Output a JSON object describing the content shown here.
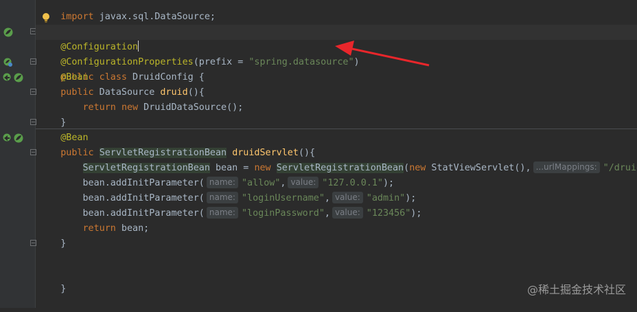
{
  "editor": {
    "lines": {
      "l0": {
        "kw": "import",
        "rest": " javax.sql.DataSource;"
      },
      "l1": {
        "ann": "@Configuration"
      },
      "l2": {
        "ann": "@ConfigurationProperties",
        "open": "(prefix = ",
        "str": "\"spring.datasource\"",
        "close": ")"
      },
      "l3": {
        "kw1": "public class",
        "rest": " DruidConfig {"
      },
      "l4": {
        "ann": "@Bean"
      },
      "l5": {
        "kw": "public",
        "type": " DataSource ",
        "method": "druid",
        "rest": "(){"
      },
      "l6": {
        "kw1": "return",
        "sp": " ",
        "kw2": "new",
        "rest": " DruidDataSource();"
      },
      "l7": {
        "rest": "}"
      },
      "l8": {
        "ann": "@Bean"
      },
      "l9": {
        "kw": "public",
        "type": "ServletRegistrationBean",
        "method": "druidServlet",
        "rest": "(){"
      },
      "l10": {
        "type": "ServletRegistrationBean",
        "mid": " bean = ",
        "kw": "new",
        "type2": "ServletRegistrationBean",
        "open": "(",
        "kw2": "new",
        "call": " StatViewServlet(),",
        "hint": "...urlMappings:",
        "str": "\"/druid"
      },
      "l11": {
        "call": "bean.addInitParameter(",
        "hint1": "name:",
        "str1": "\"allow\"",
        "comma": ",",
        "hint2": "value:",
        "str2": "\"127.0.0.1\"",
        "end": ");"
      },
      "l12": {
        "call": "bean.addInitParameter(",
        "hint1": "name:",
        "str1": "\"loginUsername\"",
        "comma": ",",
        "hint2": "value:",
        "str2": "\"admin\"",
        "end": ");"
      },
      "l13": {
        "call": "bean.addInitParameter(",
        "hint1": "name:",
        "str1": "\"loginPassword\"",
        "comma": ",",
        "hint2": "value:",
        "str2": "\"123456\"",
        "end": ");"
      },
      "l14": {
        "kw": "return",
        "rest": " bean;"
      },
      "l15": {
        "rest": "}"
      },
      "l17": {
        "rest": "}"
      }
    }
  },
  "watermark": "@稀土掘金技术社区",
  "colors": {
    "background": "#2b2b2b",
    "gutter": "#313335",
    "keyword": "#cc7832",
    "annotation": "#bbb529",
    "string": "#6a8759",
    "method": "#ffc66d",
    "text": "#a9b7c6",
    "arrow": "#e8262b"
  },
  "icons": {
    "gutter_bean": "spring-bean-icon",
    "gutter_nav": "navigate-bean-icon",
    "bulb": "lightbulb-icon",
    "fold": "fold-marker-icon"
  }
}
